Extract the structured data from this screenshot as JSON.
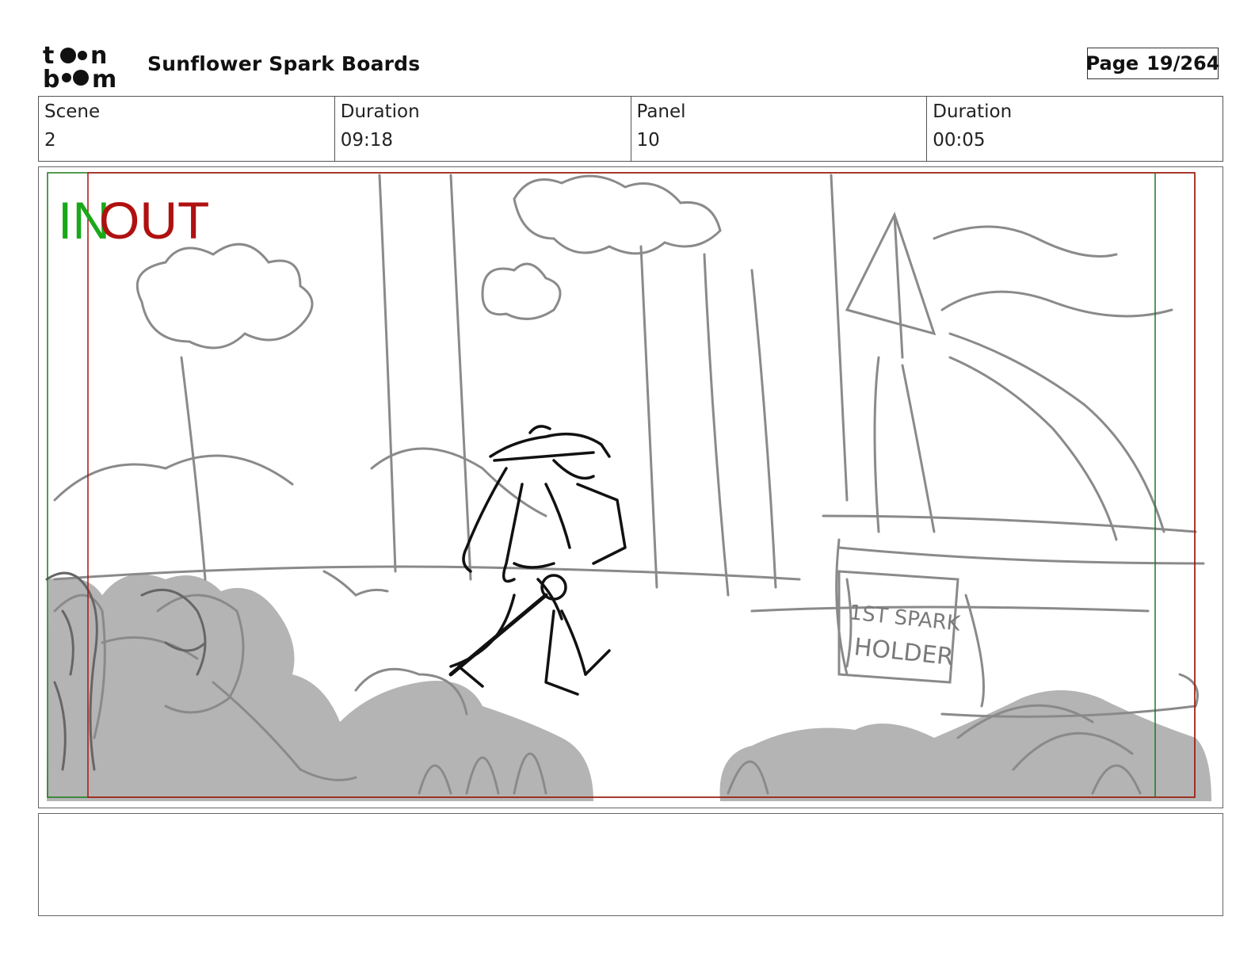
{
  "header": {
    "logo_text": "toon boom",
    "project_title": "Sunflower Spark Boards",
    "page_label": "Page",
    "page_number": "19/264"
  },
  "meta": {
    "scene_label": "Scene",
    "scene_value": "2",
    "scene_duration_label": "Duration",
    "scene_duration_value": "09:18",
    "panel_label": "Panel",
    "panel_value": "10",
    "panel_duration_label": "Duration",
    "panel_duration_value": "00:05"
  },
  "panel": {
    "in_marker": "IN",
    "out_marker": "OUT",
    "sign_line1": "1ST SPARK",
    "sign_line2": "HOLDER",
    "colors": {
      "in_green": "#1aa81a",
      "out_red": "#b01010",
      "sketch_gray": "#8a8a8a",
      "shadow_gray": "#b4b4b4",
      "ink": "#111111"
    }
  },
  "notes": {
    "text": ""
  }
}
